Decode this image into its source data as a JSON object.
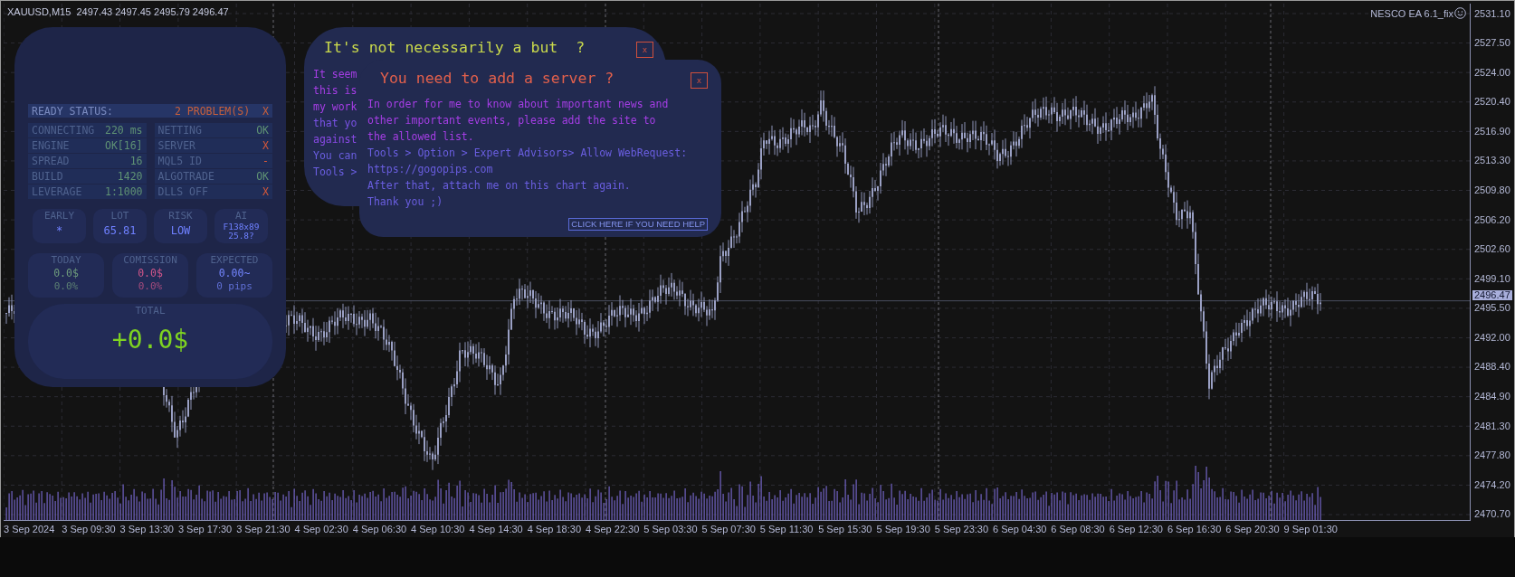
{
  "chart_header": {
    "symbol": "XAUUSD,M15",
    "ohlc": "2497.43 2497.45 2495.79 2496.47"
  },
  "expert_label": {
    "text": "NESCO EA 6.1_fix"
  },
  "price_axis": [
    "2531.10",
    "2527.50",
    "2524.00",
    "2520.40",
    "2516.90",
    "2513.30",
    "2509.80",
    "2506.20",
    "2502.60",
    "2499.10",
    "2495.50",
    "2492.00",
    "2488.40",
    "2484.90",
    "2481.30",
    "2477.80",
    "2474.20",
    "2470.70"
  ],
  "current_price": "2496.47",
  "time_axis": [
    "3 Sep 2024",
    "3 Sep 09:30",
    "3 Sep 13:30",
    "3 Sep 17:30",
    "3 Sep 21:30",
    "4 Sep 02:30",
    "4 Sep 06:30",
    "4 Sep 10:30",
    "4 Sep 14:30",
    "4 Sep 18:30",
    "4 Sep 22:30",
    "5 Sep 03:30",
    "5 Sep 07:30",
    "5 Sep 11:30",
    "5 Sep 15:30",
    "5 Sep 19:30",
    "5 Sep 23:30",
    "6 Sep 04:30",
    "6 Sep 08:30",
    "6 Sep 12:30",
    "6 Sep 16:30",
    "6 Sep 20:30",
    "9 Sep 01:30"
  ],
  "panel": {
    "ready": {
      "label": "READY STATUS:",
      "problems": "2 PROBLEM(S)",
      "mark": "X"
    },
    "status": [
      {
        "label": "CONNECTING",
        "value": "220 ms",
        "kind": "ok"
      },
      {
        "label": "NETTING",
        "value": "OK",
        "kind": "ok"
      },
      {
        "label": "ENGINE",
        "value": "OK[16]",
        "kind": "ok"
      },
      {
        "label": "SERVER",
        "value": "X",
        "kind": "fail"
      },
      {
        "label": "SPREAD",
        "value": "16",
        "kind": "ok"
      },
      {
        "label": "MQL5 ID",
        "value": "-",
        "kind": "fail"
      },
      {
        "label": "BUILD",
        "value": "1420",
        "kind": "ok"
      },
      {
        "label": "ALGOTRADE",
        "value": "OK",
        "kind": "ok"
      },
      {
        "label": "LEVERAGE",
        "value": "1:1000",
        "kind": "ok"
      },
      {
        "label": "DLLS OFF",
        "value": "X",
        "kind": "fail"
      }
    ],
    "metrics": [
      {
        "label": "EARLY",
        "kind": "big",
        "lines": [
          "*"
        ]
      },
      {
        "label": "LOT",
        "kind": "big",
        "lines": [
          "65.81"
        ]
      },
      {
        "label": "RISK",
        "kind": "big",
        "lines": [
          "LOW"
        ]
      },
      {
        "label": "AI",
        "kind": "small",
        "lines": [
          "F138x89",
          "25.8?"
        ]
      }
    ],
    "summary": [
      {
        "label": "TODAY",
        "value": "0.0$",
        "sub": "0.0%",
        "color": "#6e9c7c"
      },
      {
        "label": "COMISSION",
        "value": "0.0$",
        "sub": "0.0%",
        "color": "#d2568a"
      },
      {
        "label": "EXPECTED",
        "value": "0.00~",
        "sub": "0 pips",
        "color": "#7486ff"
      }
    ],
    "total": {
      "label": "TOTAL",
      "value": "+0.0$"
    }
  },
  "popups": [
    {
      "title": "It's not necessarily a but  ?",
      "color": "#c9d94c",
      "close": "x",
      "lines": [
        {
          "text": "It seem",
          "color": "#a63ee6"
        },
        {
          "text": "this is",
          "color": "#a63ee6"
        },
        {
          "text": "my work",
          "color": "#a63ee6"
        },
        {
          "text": "that yo",
          "color": "#7a52e6"
        },
        {
          "text": "against",
          "color": "#8a4ae6"
        },
        {
          "text": "You can",
          "color": "#6a5ee0"
        },
        {
          "text": "Tools >",
          "color": "#6a5ee0"
        }
      ]
    },
    {
      "title": "You need to add a server ?",
      "color": "#e2604c",
      "close": "x",
      "lines": [
        {
          "text": "In order for me to know about important news and",
          "color": "#a63ee6"
        },
        {
          "text": "other important events, please add the site to",
          "color": "#a63ee6"
        },
        {
          "text": "the allowed list.",
          "color": "#a63ee6"
        },
        {
          "text": "Tools > Option > Expert Advisors> Allow WebRequest:",
          "color": "#6a5ee0"
        },
        {
          "text": "https://gogopips.com",
          "color": "#6a5ee0"
        },
        {
          "text": "After that, attach me on this chart again.",
          "color": "#6a5ee0"
        },
        {
          "text": "Thank you ;)",
          "color": "#6a5ee0"
        }
      ],
      "help": "CLICK HERE IF YOU NEED HELP"
    }
  ]
}
